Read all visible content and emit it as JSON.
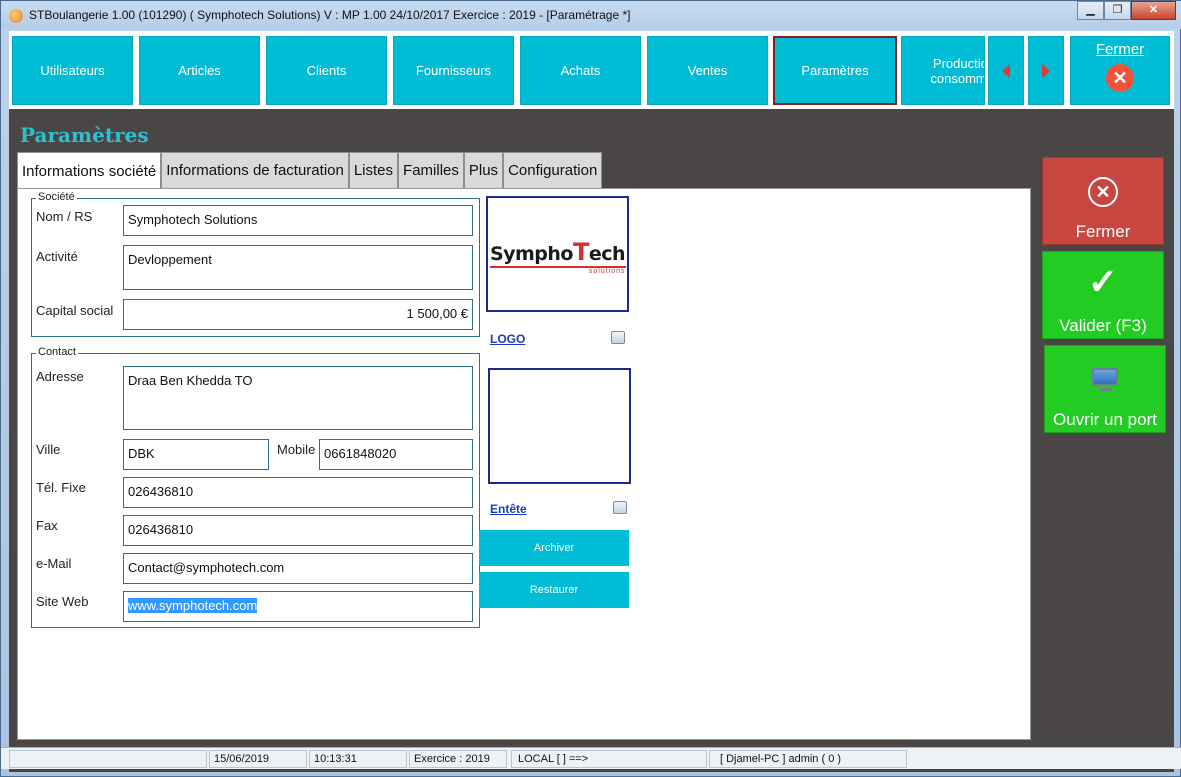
{
  "window": {
    "title": "STBoulangerie 1.00 (101290) ( Symphotech Solutions)  V : MP 1.00 24/10/2017 Exercice : 2019 - [Paramétrage *]",
    "btn_min": "▁",
    "btn_max": "❐",
    "btn_close": "✕"
  },
  "nav": {
    "items": [
      {
        "label": "Utilisateurs"
      },
      {
        "label": "Articles"
      },
      {
        "label": "Clients"
      },
      {
        "label": "Fournisseurs"
      },
      {
        "label": "Achats"
      },
      {
        "label": "Ventes"
      },
      {
        "label": "Paramètres",
        "active": true
      },
      {
        "label": "Production consommat"
      }
    ],
    "fermer_label": "Fermer",
    "fermer_icon": "✕"
  },
  "page": {
    "title": "Paramètres"
  },
  "tabs": [
    {
      "label": "Informations société"
    },
    {
      "label": "Informations de facturation"
    },
    {
      "label": "Listes"
    },
    {
      "label": "Familles"
    },
    {
      "label": "Plus"
    },
    {
      "label": "Configuration"
    }
  ],
  "societe": {
    "legend": "Société",
    "nom_label": "Nom / RS",
    "nom_value": "Symphotech Solutions",
    "activite_label": "Activité",
    "activite_value": "Devloppement",
    "capital_label": "Capital social",
    "capital_value": "1 500,00 €"
  },
  "contact": {
    "legend": "Contact",
    "adresse_label": "Adresse",
    "adresse_value": "Draa Ben Khedda TO",
    "ville_label": "Ville",
    "ville_value": "DBK",
    "mobile_label": "Mobile",
    "mobile_value": "0661848020",
    "tel_label": "Tél. Fixe",
    "tel_value": "026436810",
    "fax_label": "Fax",
    "fax_value": "026436810",
    "email_label": "e-Mail",
    "email_value": "Contact@symphotech.com",
    "site_label": "Site Web",
    "site_value": "www.symphotech.com"
  },
  "logo": {
    "brand_a": "Sympho",
    "brand_t": "T",
    "brand_b": "ech",
    "brand_sub": "solutions",
    "link_label": "LOGO"
  },
  "entete": {
    "link_label": "Entête"
  },
  "actions": {
    "archiver": "Archiver",
    "restaurer": "Restaurer"
  },
  "side": {
    "fermer": "Fermer",
    "fermer_icon": "✕",
    "valider": "Valider (F3)",
    "valider_icon": "✓",
    "port": "Ouvrir un port"
  },
  "status": {
    "date": "15/06/2019",
    "time": "10:13:31",
    "exercice": "Exercice : 2019",
    "local": "LOCAL [  ] ==>",
    "user": "[ Djamel-PC ] admin ( 0 )"
  },
  "colors": {
    "accent": "#00bcd4",
    "danger": "#c84640",
    "success": "#22cc22",
    "title": "#2fc0d0"
  }
}
